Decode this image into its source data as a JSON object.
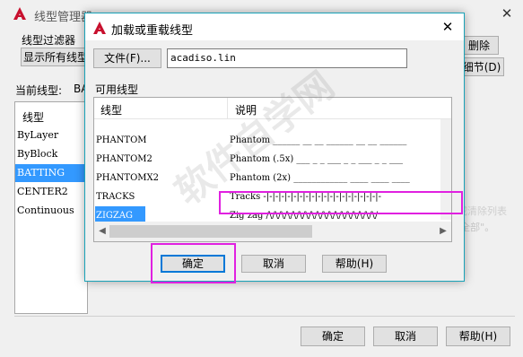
{
  "background_window": {
    "title": "线型管理器",
    "filter_label": "线型过滤器",
    "filter_dropdown": "显示所有线型",
    "delete_button": "删除",
    "details_button": "细节(D)",
    "current_label": "当前线型:",
    "current_value": "BA",
    "list_header": "线型",
    "list_items": [
      "ByLayer",
      "ByBlock",
      "BATTING",
      "CENTER2",
      "Continuous"
    ],
    "selected_item": "BATTING",
    "hint_text": "右键并选定\"选择全部\"或\"清除全部\"。",
    "hint_text_2": "重叠或清除列表",
    "ok_button": "确定",
    "cancel_button": "取消",
    "help_button": "帮助(H)"
  },
  "dialog": {
    "title": "加载或重载线型",
    "file_button": "文件(F)...",
    "file_value": "acadiso.lin",
    "available_label": "可用线型",
    "columns": [
      "线型",
      "说明"
    ],
    "rows": [
      {
        "name": "PHANTOM",
        "desc": "Phantom ______ __ __ ______ __ __ ______"
      },
      {
        "name": "PHANTOM2",
        "desc": "Phantom (.5x) ___ _ _ ___ _ _ ___ _ _ ___"
      },
      {
        "name": "PHANTOMX2",
        "desc": "Phantom (2x) ____________ ____ ____ ____"
      },
      {
        "name": "TRACKS",
        "desc": "Tracks -|-|-|-|-|-|-|-|-|-|-|-|-|-|-|-|-|-|-|-"
      },
      {
        "name": "ZIGZAG",
        "desc": "Zig zag /\\/\\/\\/\\/\\/\\/\\/\\/\\/\\/\\/\\/\\/\\/\\/\\/\\/\\/"
      }
    ],
    "selected_row": "ZIGZAG",
    "ok_button": "确定",
    "cancel_button": "取消",
    "help_button": "帮助(H)"
  },
  "watermark": "软件自学网",
  "colors": {
    "highlight": "#e020e0",
    "selection": "#3399ff",
    "dialog_border": "#1aa3b8",
    "app_icon": "#c8102e"
  },
  "icons": [
    "autocad-app-icon",
    "close-icon",
    "scroll-left-icon",
    "scroll-right-icon"
  ]
}
